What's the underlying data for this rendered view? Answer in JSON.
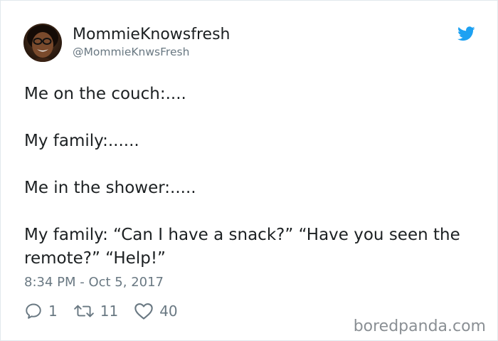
{
  "author": {
    "display_name": "MommieKnowsfresh",
    "handle": "@MommieKnwsFresh"
  },
  "tweet": {
    "lines": [
      "Me on the couch:....",
      "My family:......",
      "Me in the shower:.....",
      "My family: “Can I have a snack?” “Have you seen the remote?” “Help!”"
    ],
    "timestamp": "8:34 PM - Oct 5, 2017"
  },
  "actions": {
    "reply_count": "1",
    "retweet_count": "11",
    "like_count": "40"
  },
  "icons": {
    "reply": "reply-icon",
    "retweet": "retweet-icon",
    "like": "heart-icon",
    "brand": "twitter-bird-icon"
  },
  "colors": {
    "text": "#1c2022",
    "secondary": "#697882",
    "twitter_blue": "#1da1f2",
    "border": "#e1e8ed"
  },
  "watermark": "boredpanda.com"
}
